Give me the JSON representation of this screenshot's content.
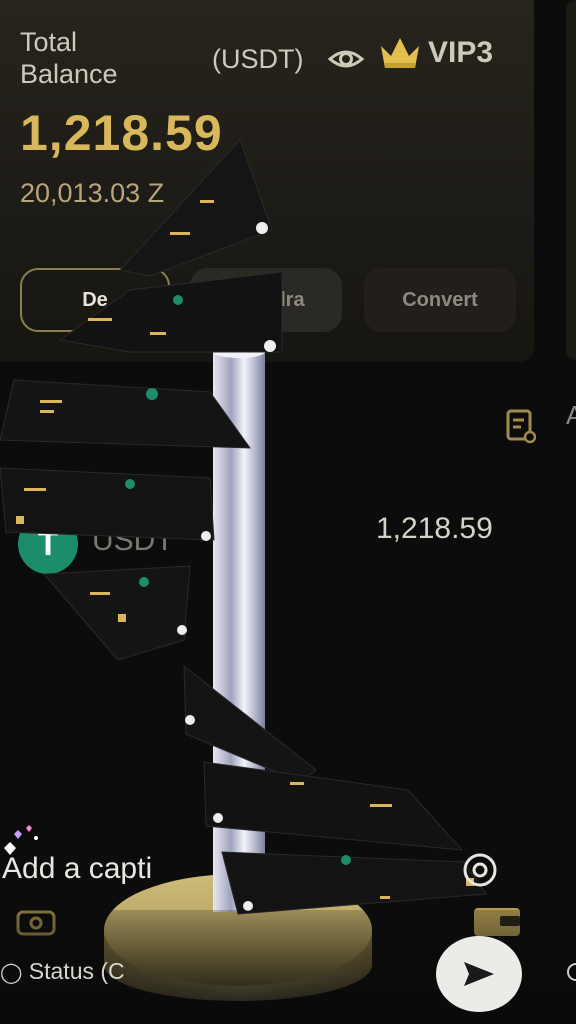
{
  "wallet": {
    "total_label": "Total\nBalance",
    "currency_label": "(USDT)",
    "vip_label": "VIP3",
    "balance": "1,218.59",
    "sub_balance": "20,013.03 Z",
    "icons": [
      "eye-icon",
      "crown-icon"
    ],
    "buttons": {
      "deposit": "De",
      "withdraw": "dra",
      "convert": "Convert"
    }
  },
  "assets": {
    "edge_letter": "A",
    "icons": [
      "clipboard-icon"
    ],
    "rows": [
      {
        "coin_glyph": "T",
        "name": "USDT",
        "value": "1,218.59"
      }
    ]
  },
  "share": {
    "caption_placeholder": "Add a capti",
    "status_label": "Status (C",
    "icons": [
      "mention-icon",
      "send-icon",
      "camera-icon",
      "wallet-icon",
      "hearts-sticker-icon"
    ]
  },
  "colors": {
    "accent_gold": "#d8b85a",
    "card_bg": "#27241c",
    "page_bg": "#0c0c0c",
    "coin_green": "#1c8d6a"
  }
}
